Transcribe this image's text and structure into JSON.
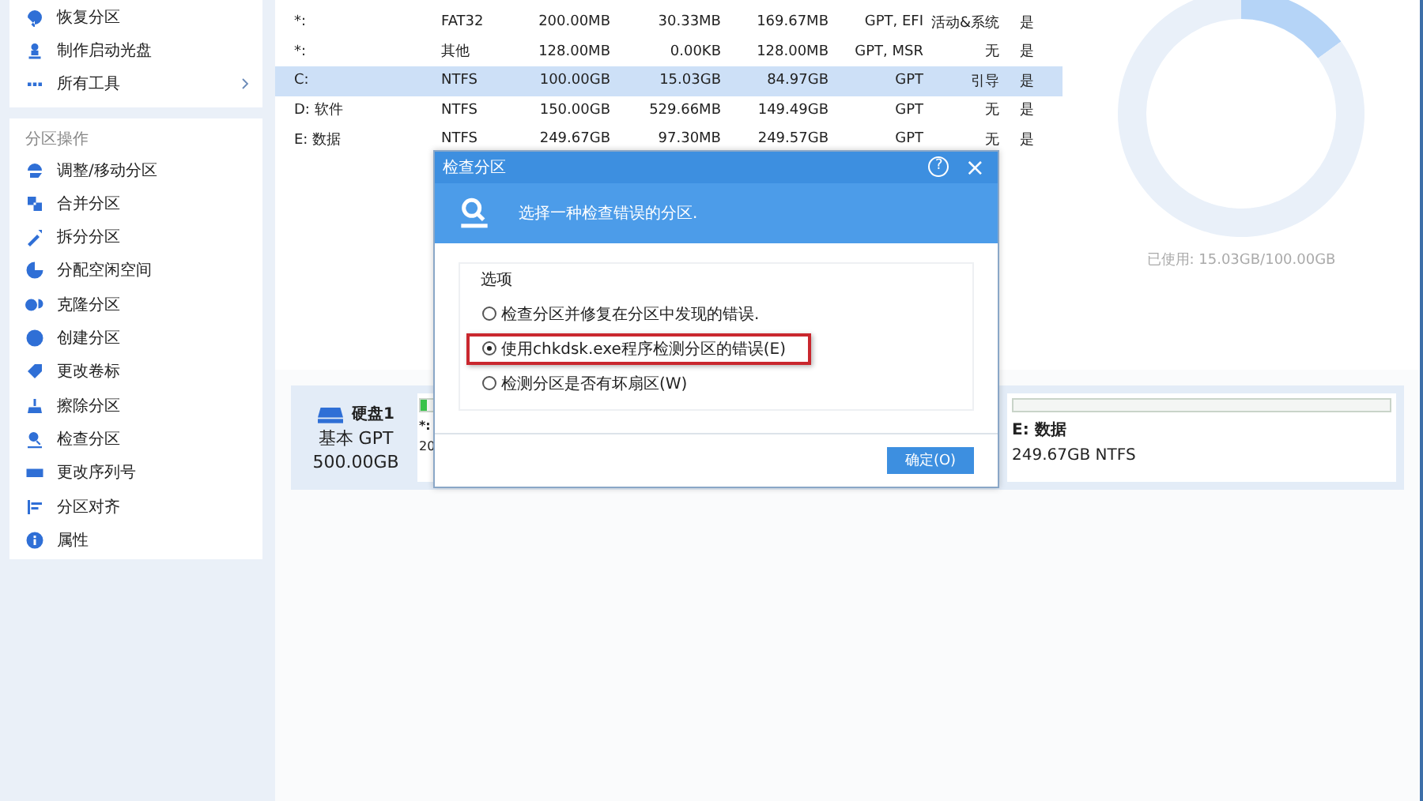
{
  "sidebar": {
    "tools": [
      {
        "label": "恢复分区",
        "kind": "action"
      },
      {
        "label": "制作启动光盘",
        "kind": "action"
      },
      {
        "label": "所有工具",
        "kind": "submenu"
      }
    ],
    "operations": {
      "title": "分区操作",
      "items": [
        "调整/移动分区",
        "合并分区",
        "拆分分区",
        "分配空闲空间",
        "克隆分区",
        "创建分区",
        "更改卷标",
        "擦除分区",
        "检查分区",
        "更改序列号",
        "分区对齐",
        "属性"
      ]
    }
  },
  "table": {
    "rows": [
      {
        "name": "*:",
        "fs": "FAT32",
        "capacity": "200.00MB",
        "used": "30.33MB",
        "unused": "169.67MB",
        "type": "GPT, EFI",
        "status": "活动&系统",
        "column_8": "是",
        "selected": false
      },
      {
        "name": "*:",
        "fs": "其他",
        "capacity": "128.00MB",
        "used": "0.00KB",
        "unused": "128.00MB",
        "type": "GPT, MSR",
        "status": "无",
        "column_8": "是",
        "selected": false
      },
      {
        "name": "C:",
        "fs": "NTFS",
        "capacity": "100.00GB",
        "used": "15.03GB",
        "unused": "84.97GB",
        "type": "GPT",
        "status": "引导",
        "column_8": "是",
        "selected": true
      },
      {
        "name": "D: 软件",
        "fs": "NTFS",
        "capacity": "150.00GB",
        "used": "529.66MB",
        "unused": "149.49GB",
        "type": "GPT",
        "status": "无",
        "column_8": "是",
        "selected": false
      },
      {
        "name": "E: 数据",
        "fs": "NTFS",
        "capacity": "249.67GB",
        "used": "97.30MB",
        "unused": "249.57GB",
        "type": "GPT",
        "status": "无",
        "column_8": "是",
        "selected": false
      }
    ]
  },
  "usage": {
    "chart_data": {
      "type": "donut",
      "values": [
        15.03,
        84.97
      ]
    },
    "caption": "已使用: 15.03GB/100.00GB"
  },
  "disk_map": {
    "disk": {
      "name": "硬盘1",
      "type": "基本 GPT",
      "size": "500.00GB"
    },
    "partitions": [
      {
        "name": "*:",
        "size": "20",
        "level": 0.5
      },
      {
        "name": "E: 数据",
        "size": "249.67GB NTFS",
        "level": 0
      }
    ]
  },
  "dialog": {
    "title": "检查分区",
    "help": "?",
    "close": "×",
    "header": "选择一种检查错误的分区.",
    "group_title": "选项",
    "options": [
      {
        "label": "检查分区并修复在分区中发现的错误.",
        "selected": false,
        "highlighted": false
      },
      {
        "label": "使用chkdsk.exe程序检测分区的错误(E)",
        "selected": true,
        "highlighted": true
      },
      {
        "label": "检测分区是否有坏扇区(W)",
        "selected": false,
        "highlighted": false
      }
    ],
    "ok_button": "确定(O)"
  }
}
